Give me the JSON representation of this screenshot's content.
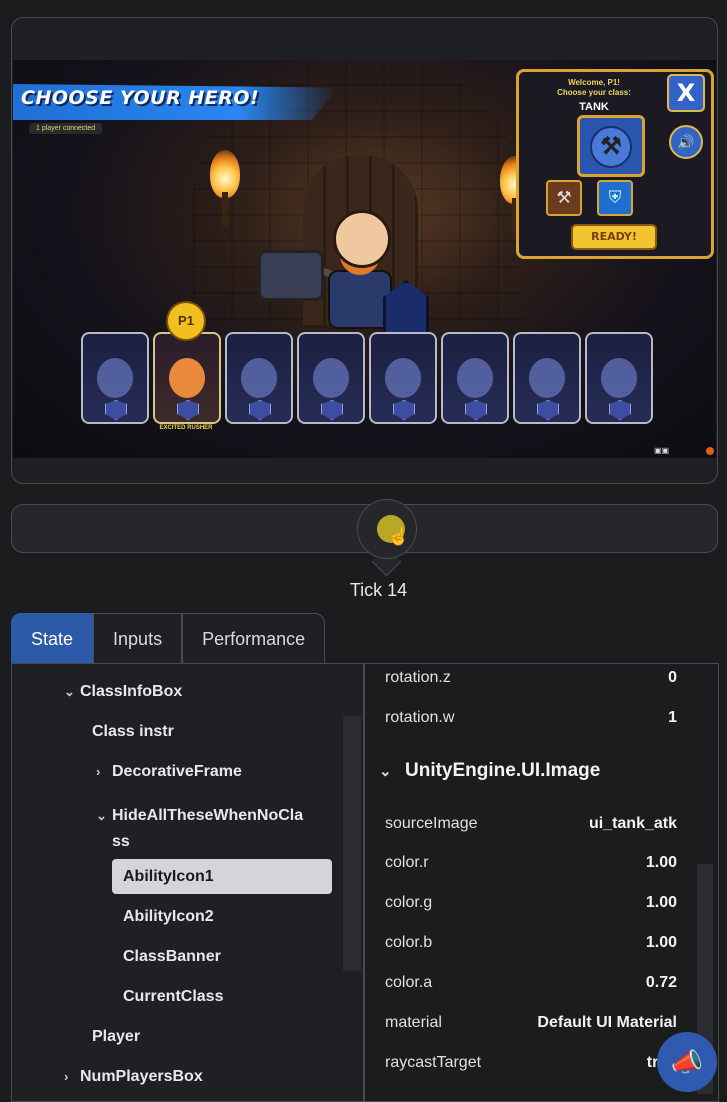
{
  "game": {
    "title": "CHOOSE YOUR HERO!",
    "players_connected": "1 player connected",
    "class_box": {
      "welcome": "Welcome, P1!",
      "choose": "Choose your class:",
      "class_name": "TANK",
      "ready_label": "READY!",
      "close_label": "X"
    },
    "player_tag": "P1",
    "hero_name": "EXCITED RUSHER"
  },
  "timeline": {
    "tick_label": "Tick 14"
  },
  "tabs": [
    "State",
    "Inputs",
    "Performance"
  ],
  "tree": {
    "items": [
      {
        "label": "ClassInfoBox",
        "caret": "⌄"
      },
      {
        "label": "Class instr",
        "caret": ""
      },
      {
        "label": "DecorativeFrame",
        "caret": "›"
      },
      {
        "label": "HideAllTheseWhenNoCla",
        "label2": "ss",
        "caret": "⌄"
      },
      {
        "label": "AbilityIcon1",
        "caret": ""
      },
      {
        "label": "AbilityIcon2",
        "caret": ""
      },
      {
        "label": "ClassBanner",
        "caret": ""
      },
      {
        "label": "CurrentClass",
        "caret": ""
      },
      {
        "label": "Player",
        "caret": ""
      },
      {
        "label": "NumPlayersBox",
        "caret": "›"
      }
    ]
  },
  "properties": {
    "top_rows": [
      {
        "key": "rotation.z",
        "value": "0"
      },
      {
        "key": "rotation.w",
        "value": "1"
      }
    ],
    "section_title": "UnityEngine.UI.Image",
    "section_rows": [
      {
        "key": "sourceImage",
        "value": "ui_tank_atk"
      },
      {
        "key": "color.r",
        "value": "1.00"
      },
      {
        "key": "color.g",
        "value": "1.00"
      },
      {
        "key": "color.b",
        "value": "1.00"
      },
      {
        "key": "color.a",
        "value": "0.72"
      },
      {
        "key": "material",
        "value": "Default UI Material"
      },
      {
        "key": "raycastTarget",
        "value": "true"
      }
    ]
  },
  "colors": {
    "accent": "#2d5aa8",
    "scrub": "#b9a827"
  }
}
